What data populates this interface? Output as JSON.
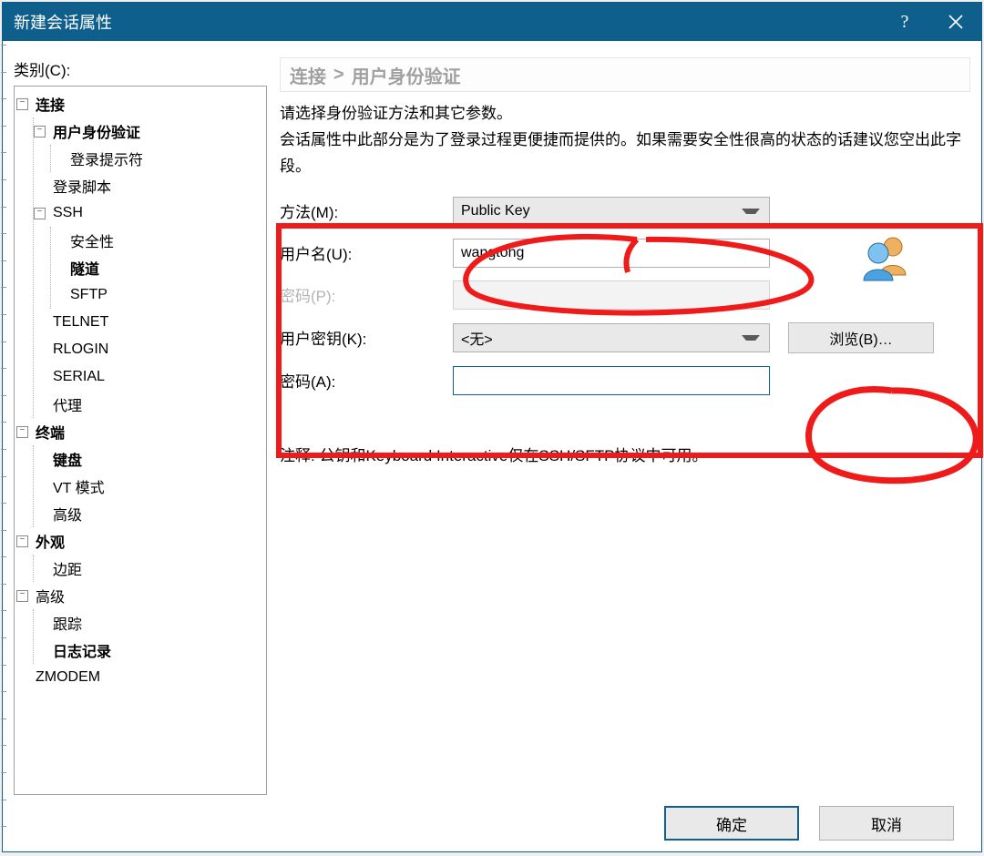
{
  "titlebar": {
    "title": "新建会话属性"
  },
  "category_label": "类别(C):",
  "tree": {
    "connection": "连接",
    "user_auth": "用户身份验证",
    "login_prompt": "登录提示符",
    "login_script": "登录脚本",
    "ssh": "SSH",
    "security": "安全性",
    "tunnel": "隧道",
    "sftp": "SFTP",
    "telnet": "TELNET",
    "rlogin": "RLOGIN",
    "serial": "SERIAL",
    "proxy": "代理",
    "terminal": "终端",
    "keyboard": "键盘",
    "vt_mode": "VT 模式",
    "advanced_term": "高级",
    "appearance": "外观",
    "margin": "边距",
    "advanced": "高级",
    "trace": "跟踪",
    "logging": "日志记录",
    "zmodem": "ZMODEM"
  },
  "breadcrumb": {
    "a": "连接",
    "b": "用户身份验证"
  },
  "description": {
    "line1": "请选择身份验证方法和其它参数。",
    "line2": "会话属性中此部分是为了登录过程更便捷而提供的。如果需要安全性很高的状态的话建议您空出此字段。"
  },
  "form": {
    "method_label": "方法(M):",
    "method_value": "Public Key",
    "username_label": "用户名(U):",
    "username_value": "wangtong",
    "password_label": "密码(P):",
    "password_value": "",
    "userkey_label": "用户密钥(K):",
    "userkey_value": "<无>",
    "browse_label": "浏览(B)…",
    "passphrase_label": "密码(A):",
    "passphrase_value": ""
  },
  "note": "注释: 公钥和Keyboard Interactive仅在SSH/SFTP协议中可用。",
  "footer": {
    "ok": "确定",
    "cancel": "取消"
  }
}
